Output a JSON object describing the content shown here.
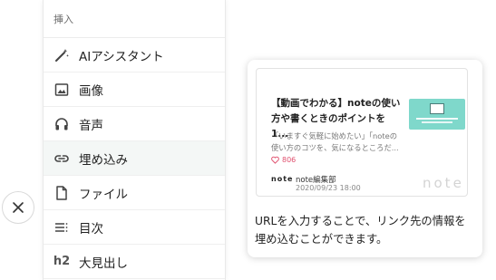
{
  "close_button": {
    "icon": "close-icon"
  },
  "menu": {
    "header": "挿入",
    "items": [
      {
        "label": "AIアシスタント",
        "icon": "magic-wand-icon",
        "active": false
      },
      {
        "label": "画像",
        "icon": "image-icon",
        "active": false
      },
      {
        "label": "音声",
        "icon": "headphones-icon",
        "active": false
      },
      {
        "label": "埋め込み",
        "icon": "link-icon",
        "active": true
      },
      {
        "label": "ファイル",
        "icon": "file-icon",
        "active": false
      },
      {
        "label": "目次",
        "icon": "toc-icon",
        "active": false
      },
      {
        "label": "大見出し",
        "icon": "h2-icon",
        "prefix": "h2",
        "active": false
      }
    ]
  },
  "preview": {
    "card": {
      "title": "【動画でわかる】noteの使い方や書くときのポイントを1...",
      "excerpt": "「いますぐ気軽に始めたい」「noteの使い方のコツを、気になるところだ...",
      "likes": "806",
      "small_logo": "note",
      "author": "note編集部",
      "date": "2020/09/23 18:00",
      "big_logo": "note"
    },
    "description": "URLを入力することで、リンク先の情報を埋め込むことができます。"
  },
  "colors": {
    "active_bg": "#f4f7f6",
    "like_red": "#e0506e",
    "thumb_teal": "#7fd8cb"
  }
}
